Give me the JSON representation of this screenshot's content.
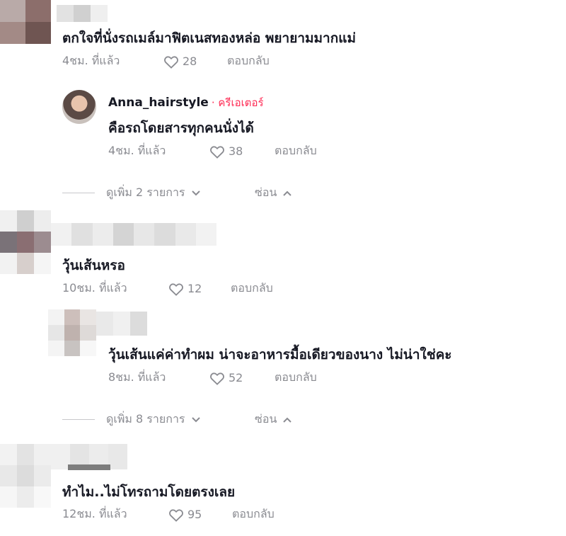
{
  "comments": [
    {
      "text": "ตกใจที่นั่งรถเมล์มาฟิตเนสทองหล่อ พยายามมากแม่",
      "time": "4ชม. ที่แล้ว",
      "likes": "28",
      "reply_label": "ตอบกลับ",
      "replies": [
        {
          "username": "Anna_hairstyle",
          "badge": "· ครีเอเตอร์",
          "text": "คือรถโดยสารทุกคนนั่งได้",
          "time": "4ชม. ที่แล้ว",
          "likes": "38",
          "reply_label": "ตอบกลับ"
        }
      ],
      "view_more": "ดูเพิ่ม 2 รายการ",
      "hide": "ซ่อน"
    },
    {
      "text": "วุ้นเส้นหรอ",
      "time": "10ชม. ที่แล้ว",
      "likes": "12",
      "reply_label": "ตอบกลับ",
      "replies": [
        {
          "text": "วุ้นเส้นแค่ค่าทำผม น่าจะอาหารมื้อเดียวของนาง ไม่น่าใช่คะ",
          "time": "8ชม. ที่แล้ว",
          "likes": "52",
          "reply_label": "ตอบกลับ"
        }
      ],
      "view_more": "ดูเพิ่ม 8 รายการ",
      "hide": "ซ่อน"
    },
    {
      "text": "ทำไม..ไม่โทรถามโดยตรงเลย",
      "time": "12ชม. ที่แล้ว",
      "likes": "95",
      "reply_label": "ตอบกลับ"
    }
  ],
  "icons": {
    "like": "heart-outline-icon",
    "chevron_down": "chevron-down-icon",
    "chevron_up": "chevron-up-icon"
  },
  "colors": {
    "text": "#161823",
    "muted": "#8a8b91",
    "creator_badge": "#fe2c55"
  }
}
